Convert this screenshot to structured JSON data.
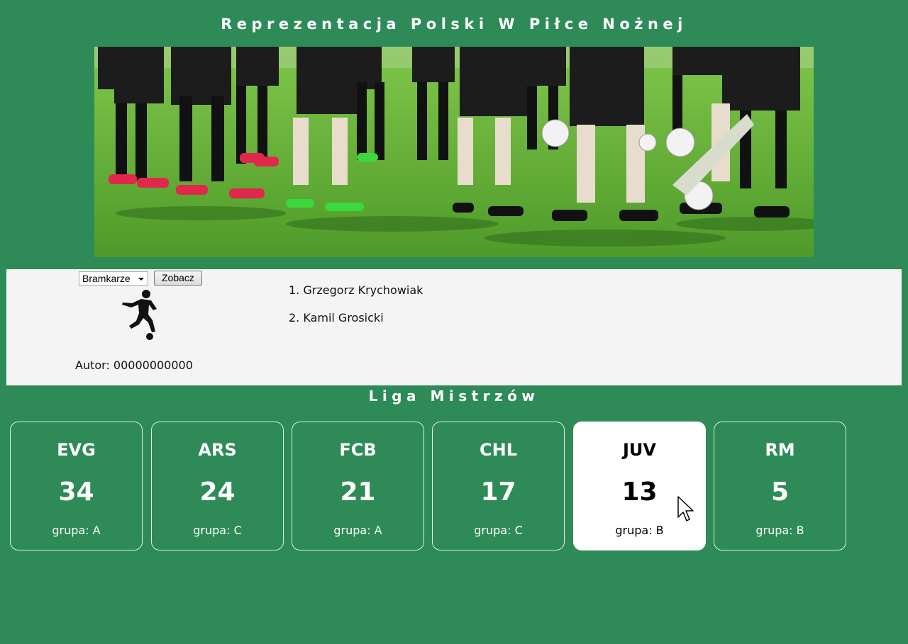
{
  "header": {
    "title": "Reprezentacja Polski W Piłce Nożnej"
  },
  "banner": {
    "image": "football-team-training-photo"
  },
  "controls": {
    "select_value": "Bramkarze",
    "button_label": "Zobacz"
  },
  "panel": {
    "player_icon": "football-player-silhouette-icon",
    "author": "Autor: 00000000000",
    "players": [
      "1. Grzegorz Krychowiak",
      "2. Kamil Grosicki"
    ]
  },
  "league": {
    "title": "Liga Mistrzów",
    "teams": [
      {
        "code": "EVG",
        "points": "34",
        "group": "grupa: A"
      },
      {
        "code": "ARS",
        "points": "24",
        "group": "grupa: C"
      },
      {
        "code": "FCB",
        "points": "21",
        "group": "grupa: A"
      },
      {
        "code": "CHL",
        "points": "17",
        "group": "grupa: C"
      },
      {
        "code": "JUV",
        "points": "13",
        "group": "grupa: B"
      },
      {
        "code": "RM",
        "points": "5",
        "group": "grupa: B"
      }
    ],
    "hovered_team": "JUV"
  },
  "colors": {
    "background": "#2e8b57",
    "panel": "#f4f4f4",
    "card_border": "#dfeee6",
    "card_active": "#ffffff"
  }
}
